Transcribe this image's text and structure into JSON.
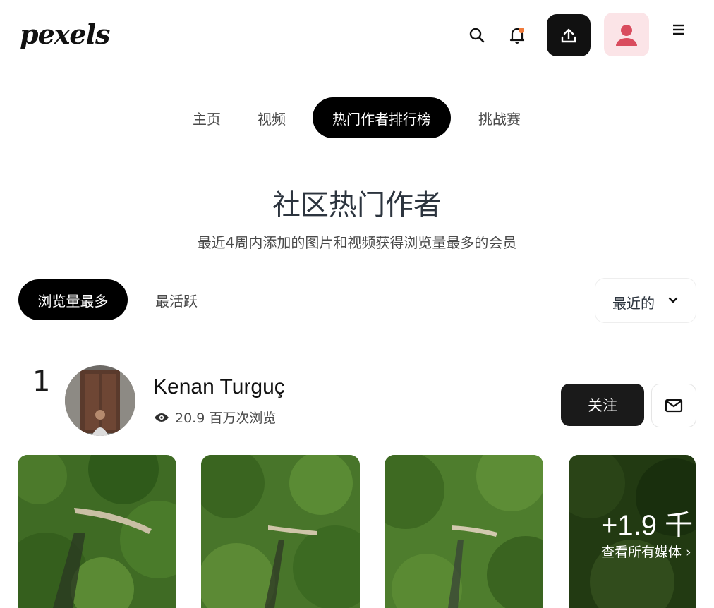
{
  "header": {
    "logo_text": "pexels",
    "icons": [
      "search-icon",
      "bell-icon",
      "upload-icon",
      "user-avatar-icon",
      "menu-icon"
    ],
    "notification_dot_color": "#f07a3a",
    "avatar_color": "#d94c5e"
  },
  "nav": {
    "tabs": [
      "主页",
      "视频",
      "热门作者排行榜",
      "挑战赛"
    ],
    "active_index": 2
  },
  "page": {
    "title": "社区热门作者",
    "subtitle": "最近4周内添加的图片和视频获得浏览量最多的会员"
  },
  "filters": {
    "tabs": [
      "浏览量最多",
      "最活跃"
    ],
    "active_index": 0,
    "sort_label": "最近的"
  },
  "creator": {
    "rank": "1",
    "name": "Kenan Turguç",
    "views": "20.9 百万次浏览",
    "follow_label": "关注",
    "more_count": "+1.9 千",
    "more_label": "查看所有媒体 ›"
  },
  "colors": {
    "black": "#000000",
    "dark_button": "#1a1a1a",
    "forest": "#3f6b24"
  }
}
